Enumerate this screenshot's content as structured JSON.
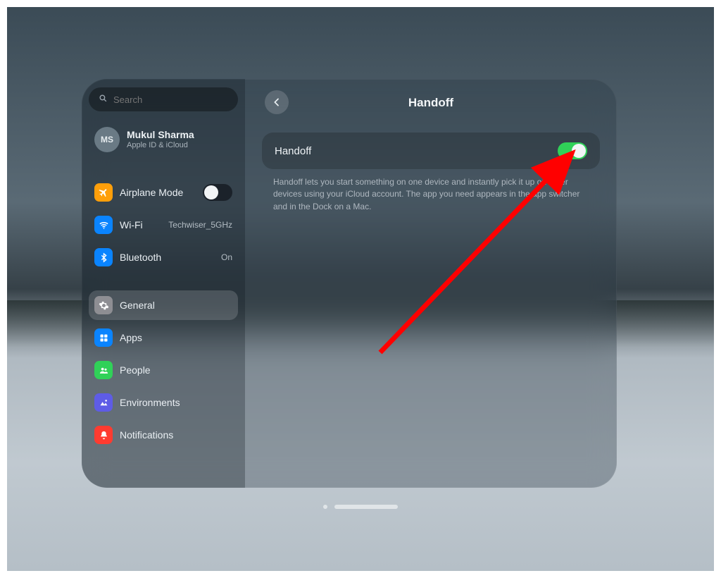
{
  "search": {
    "placeholder": "Search"
  },
  "profile": {
    "initials": "MS",
    "name": "Mukul Sharma",
    "subtitle": "Apple ID & iCloud"
  },
  "sidebar": {
    "airplane": {
      "label": "Airplane Mode",
      "on": false,
      "icon_bg": "#ff9f0a"
    },
    "wifi": {
      "label": "Wi-Fi",
      "value": "Techwiser_5GHz",
      "icon_bg": "#0a84ff"
    },
    "bluetooth": {
      "label": "Bluetooth",
      "value": "On",
      "icon_bg": "#0a84ff"
    },
    "general": {
      "label": "General",
      "icon_bg": "#8e8e93"
    },
    "apps": {
      "label": "Apps",
      "icon_bg": "#0a84ff"
    },
    "people": {
      "label": "People",
      "icon_bg": "#30d158"
    },
    "environments": {
      "label": "Environments",
      "icon_bg": "#5e5ce6"
    },
    "notifications": {
      "label": "Notifications",
      "icon_bg": "#ff3b30"
    }
  },
  "content": {
    "title": "Handoff",
    "row_label": "Handoff",
    "toggle_on": true,
    "description": "Handoff lets you start something on one device and instantly pick it up on other devices using your iCloud account. The app you need appears in the app switcher and in the Dock on a Mac."
  },
  "annotation": {
    "arrow_color": "#ff0000"
  }
}
